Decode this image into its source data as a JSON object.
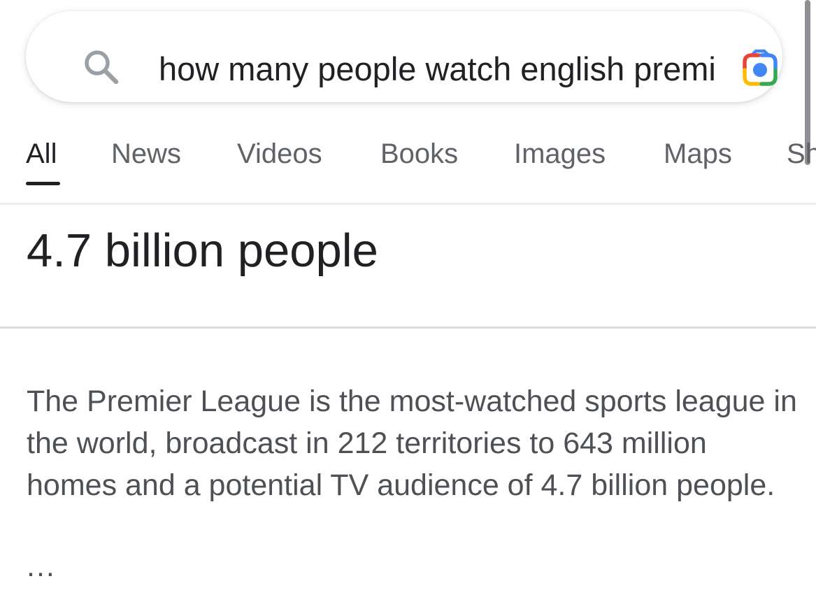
{
  "search": {
    "query": "how many people watch english premier league"
  },
  "tabs": [
    {
      "label": "All",
      "active": true
    },
    {
      "label": "News"
    },
    {
      "label": "Videos"
    },
    {
      "label": "Books"
    },
    {
      "label": "Images"
    },
    {
      "label": "Maps"
    },
    {
      "label": "Sh"
    }
  ],
  "answer": {
    "headline": "4.7 billion people",
    "snippet": "The Premier League is the most-watched sports league in the world, broadcast in 212 territories to 643 million homes and a potential TV audience of 4.7 billion people.",
    "more": "..."
  },
  "icons": {
    "search": "search-icon",
    "camera": "google-lens-camera-icon"
  },
  "colors": {
    "text_primary": "#202124",
    "text_secondary": "#5f6368",
    "snippet_text": "#4d5156",
    "lens_blue": "#4285f4",
    "lens_red": "#ea4335",
    "lens_yellow": "#fbbc04",
    "lens_green": "#34a853"
  }
}
